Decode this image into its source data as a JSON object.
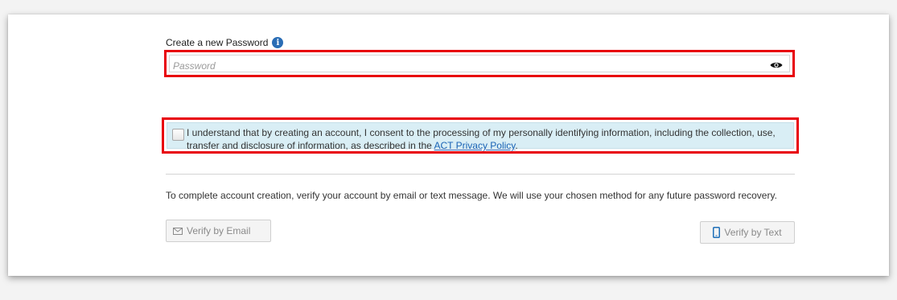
{
  "password_section": {
    "label": "Create a new Password",
    "info_icon": "info-icon",
    "input_placeholder": "Password",
    "input_value": "",
    "toggle_icon": "eye-icon"
  },
  "consent": {
    "checked": false,
    "text_before_link": "I understand that by creating an account, I consent to the processing of my personally identifying information, including the collection, use, transfer and disclosure of information, as described in the ",
    "link_text": "ACT Privacy Policy",
    "text_after_link": "."
  },
  "verification": {
    "instructions": "To complete account creation, verify your account by email or text message. We will use your chosen method for any future password recovery.",
    "email_button_label": "Verify by Email",
    "email_button_icon": "envelope-icon",
    "text_button_label": "Verify by Text",
    "text_button_icon": "mobile-phone-icon"
  },
  "colors": {
    "highlight_border": "#e8000b",
    "consent_background": "#d9eef5",
    "link": "#1a63b5",
    "info_icon": "#2a6db5"
  }
}
